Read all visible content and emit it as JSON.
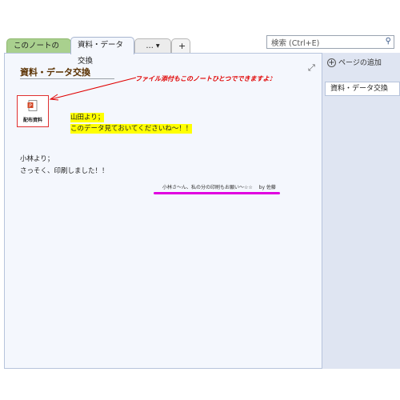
{
  "tabs": {
    "notebook_features": "このノートの特長",
    "active": "資料・データ交換",
    "more": "…  ▾",
    "add": "+"
  },
  "search": {
    "placeholder": "検索 (Ctrl+E)",
    "icon": "search-icon"
  },
  "page": {
    "title": "資料・データ交換",
    "annotation": "ファイル添付もこのノートひとつでできますよ♪",
    "attachment_label": "配布資料",
    "yamada_line1": "山田より；",
    "yamada_line2": "このデータ見ておいてくださいね～！！",
    "kobayashi_line1": "小林より；",
    "kobayashi_line2": "さっそく、印刷しました！！",
    "small_note": "小林さ～ん、私の分の印刷もお願い～☆☆　 by 佐藤",
    "colors": {
      "highlight": "#ffff00",
      "marker": "#e000e0",
      "annotation": "#e00000"
    }
  },
  "sidebar": {
    "add_page": "ページの追加",
    "pages": [
      "資料・データ交換"
    ]
  }
}
